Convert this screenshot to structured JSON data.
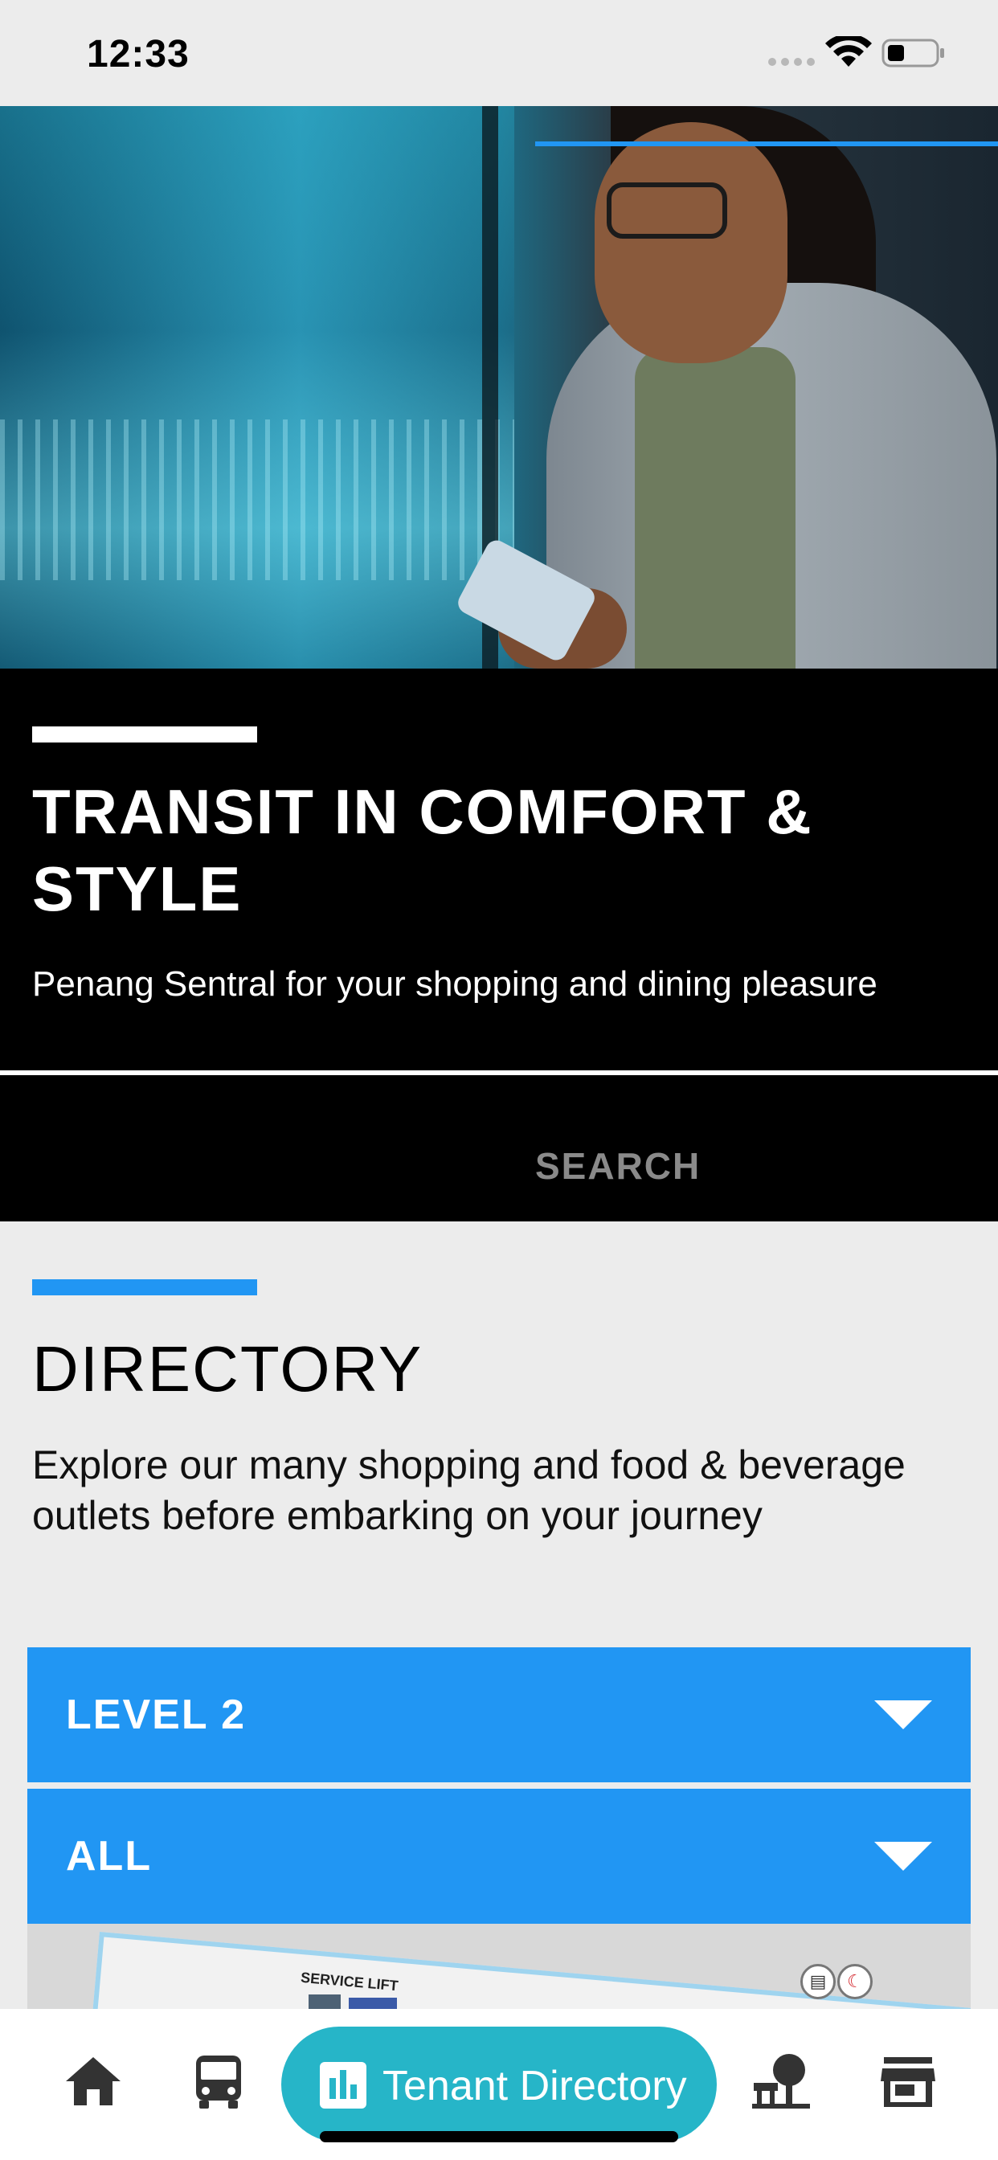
{
  "status_bar": {
    "time": "12:33"
  },
  "banner": {
    "title": "TRANSIT IN COMFORT & STYLE",
    "subtitle": "Penang Sentral for your shopping and dining pleasure"
  },
  "tabs": {
    "search_label": "SEARCH"
  },
  "directory": {
    "title": "DIRECTORY",
    "description": "Explore our many shopping and food & beverage outlets before embarking on your journey",
    "level_dropdown": "LEVEL 2",
    "category_dropdown": "ALL"
  },
  "map": {
    "label": "SERVICE LIFT"
  },
  "bottom_nav": {
    "active_label": "Tenant Directory",
    "items": [
      "home-icon",
      "bus-icon",
      "tenant-directory-icon",
      "park-icon",
      "store-icon"
    ]
  },
  "colors": {
    "accent": "#2196f3",
    "active_nav": "#26b5c8",
    "banner_bg": "#000000"
  }
}
